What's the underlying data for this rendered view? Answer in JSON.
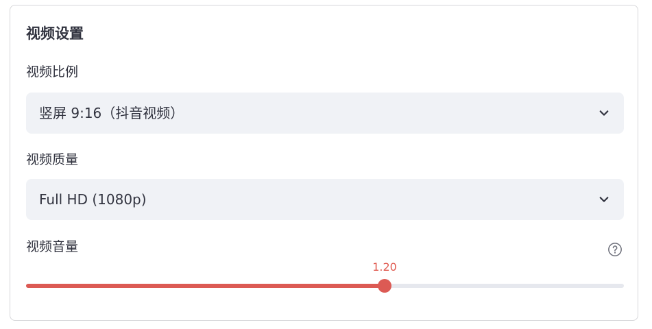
{
  "panel": {
    "title": "视频设置"
  },
  "aspect_ratio": {
    "label": "视频比例",
    "selected": "竖屏 9:16（抖音视频）"
  },
  "quality": {
    "label": "视频质量",
    "selected": "Full HD (1080p)"
  },
  "volume": {
    "label": "视频音量",
    "value_text": "1.20",
    "fill_fraction": 0.6
  },
  "icons": {
    "select_chevron": "chevron-down-icon",
    "help": "help-circle-icon"
  },
  "colors": {
    "accent": "#dc5a54",
    "select_bg": "#f0f2f6",
    "track": "#e6e8ee",
    "border": "#d6d6d9",
    "text": "#31333f"
  }
}
